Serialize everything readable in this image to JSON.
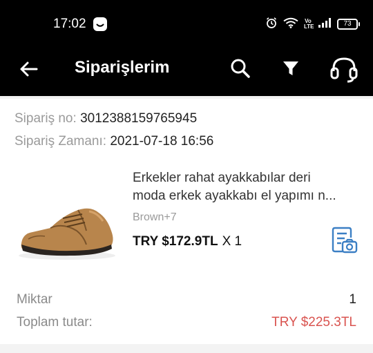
{
  "status_bar": {
    "time": "17:02",
    "battery": "73",
    "network_badge_line1": "Vo",
    "network_badge_line2": "LTE"
  },
  "app_bar": {
    "title": "Siparişlerim",
    "icons": [
      "back-arrow-icon",
      "search-icon",
      "filter-icon",
      "headset-support-icon"
    ]
  },
  "order": {
    "number_label": "Sipariş no:",
    "number": "3012388159765945",
    "time_label": "Sipariş Zamanı:",
    "time": "2021-07-18 16:56"
  },
  "product": {
    "title_line1": "Erkekler rahat ayakkabılar deri",
    "title_line2": "moda erkek ayakkabı el yapımı n...",
    "variant": "Brown+7",
    "price": "TRY $172.9TL",
    "quantity": "X 1"
  },
  "summary": {
    "quantity_label": "Miktar",
    "quantity_value": "1",
    "total_label": "Toplam tutar:",
    "total_value": "TRY $225.3TL"
  },
  "colors": {
    "header_bg": "#000000",
    "total_price": "#d9534f",
    "review_icon": "#3b7fc4"
  }
}
